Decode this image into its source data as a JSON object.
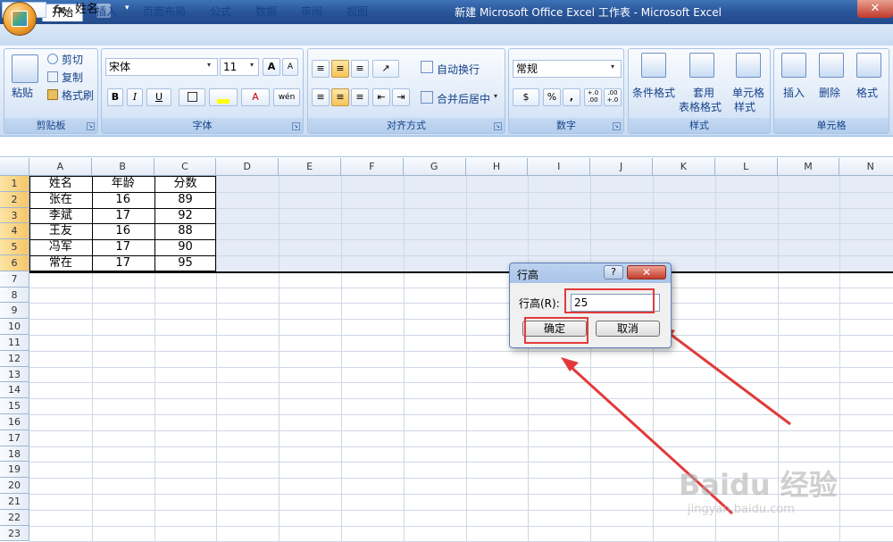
{
  "window": {
    "title": "新建 Microsoft Office Excel 工作表 - Microsoft Excel",
    "close_glyph": "✕"
  },
  "tabs": [
    "开始",
    "插入",
    "页面布局",
    "公式",
    "数据",
    "审阅",
    "视图"
  ],
  "ribbon": {
    "clipboard": {
      "paste": "粘贴",
      "cut": "剪切",
      "copy": "复制",
      "format_painter": "格式刷",
      "label": "剪贴板"
    },
    "font": {
      "name": "宋体",
      "size": "11",
      "label": "字体",
      "bold": "B",
      "italic": "I",
      "underline": "U",
      "grow": "A",
      "shrink": "A",
      "color_letter": "A",
      "phonetic": "wén"
    },
    "alignment": {
      "wrap": "自动换行",
      "merge": "合并后居中",
      "label": "对齐方式"
    },
    "number": {
      "format": "常规",
      "label": "数字",
      "percent": "%",
      "comma": ",",
      "inc_decimal": "+.0\n.00",
      "dec_decimal": ".00\n+.0"
    },
    "styles": {
      "conditional": "条件格式",
      "table_1": "套用",
      "table_2": "表格格式",
      "cell_styles_1": "单元格",
      "cell_styles_2": "样式",
      "label": "样式"
    },
    "cells": {
      "insert": "插入",
      "delete": "删除",
      "format": "格式",
      "label": "单元格"
    }
  },
  "formula_bar": {
    "fx": "fx",
    "content": "姓名"
  },
  "columns": [
    "A",
    "B",
    "C",
    "D",
    "E",
    "F",
    "G",
    "H",
    "I",
    "J",
    "K",
    "L",
    "M",
    "N"
  ],
  "rows": [
    "1",
    "2",
    "3",
    "4",
    "5",
    "6",
    "7",
    "8",
    "9",
    "10",
    "11",
    "12",
    "13",
    "14",
    "15",
    "16",
    "17",
    "18",
    "19",
    "20",
    "21",
    "22",
    "23"
  ],
  "table": [
    [
      "姓名",
      "年龄",
      "分数"
    ],
    [
      "张在",
      "16",
      "89"
    ],
    [
      "李斌",
      "17",
      "92"
    ],
    [
      "王友",
      "16",
      "88"
    ],
    [
      "冯军",
      "17",
      "90"
    ],
    [
      "常在",
      "17",
      "95"
    ]
  ],
  "dialog": {
    "title": "行高",
    "help": "?",
    "close": "✕",
    "label": "行高(R):",
    "value": "25",
    "ok": "确定",
    "cancel": "取消"
  },
  "watermark": {
    "text": "Baidu 经验",
    "url": "jingyan.baidu.com"
  },
  "colors": {
    "annotation": "#e23a3a",
    "ribbon_text": "#15428b"
  }
}
